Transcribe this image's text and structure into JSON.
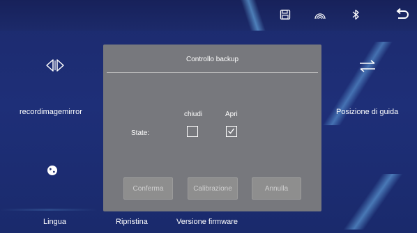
{
  "topbar": {
    "icons": [
      "save-icon",
      "signal-icon",
      "bluetooth-icon",
      "back-icon"
    ]
  },
  "menu": {
    "record_image_mirror": "recordimagemirror",
    "driving_position": "Posizione di guida",
    "language": "Lingua",
    "restore": "Ripristina",
    "firmware_version": "Versione firmware"
  },
  "dialog": {
    "title": "Controllo backup",
    "state_label": "State:",
    "options": [
      {
        "label": "chiudi",
        "checked": false
      },
      {
        "label": "Apri",
        "checked": true
      }
    ],
    "buttons": {
      "confirm": "Conferma",
      "calibration": "Calibrazione",
      "cancel": "Annulla"
    }
  },
  "colors": {
    "background": "#1c2a6d",
    "overlay": "#7e7e7e",
    "accent_streak": "#78c8ff"
  }
}
